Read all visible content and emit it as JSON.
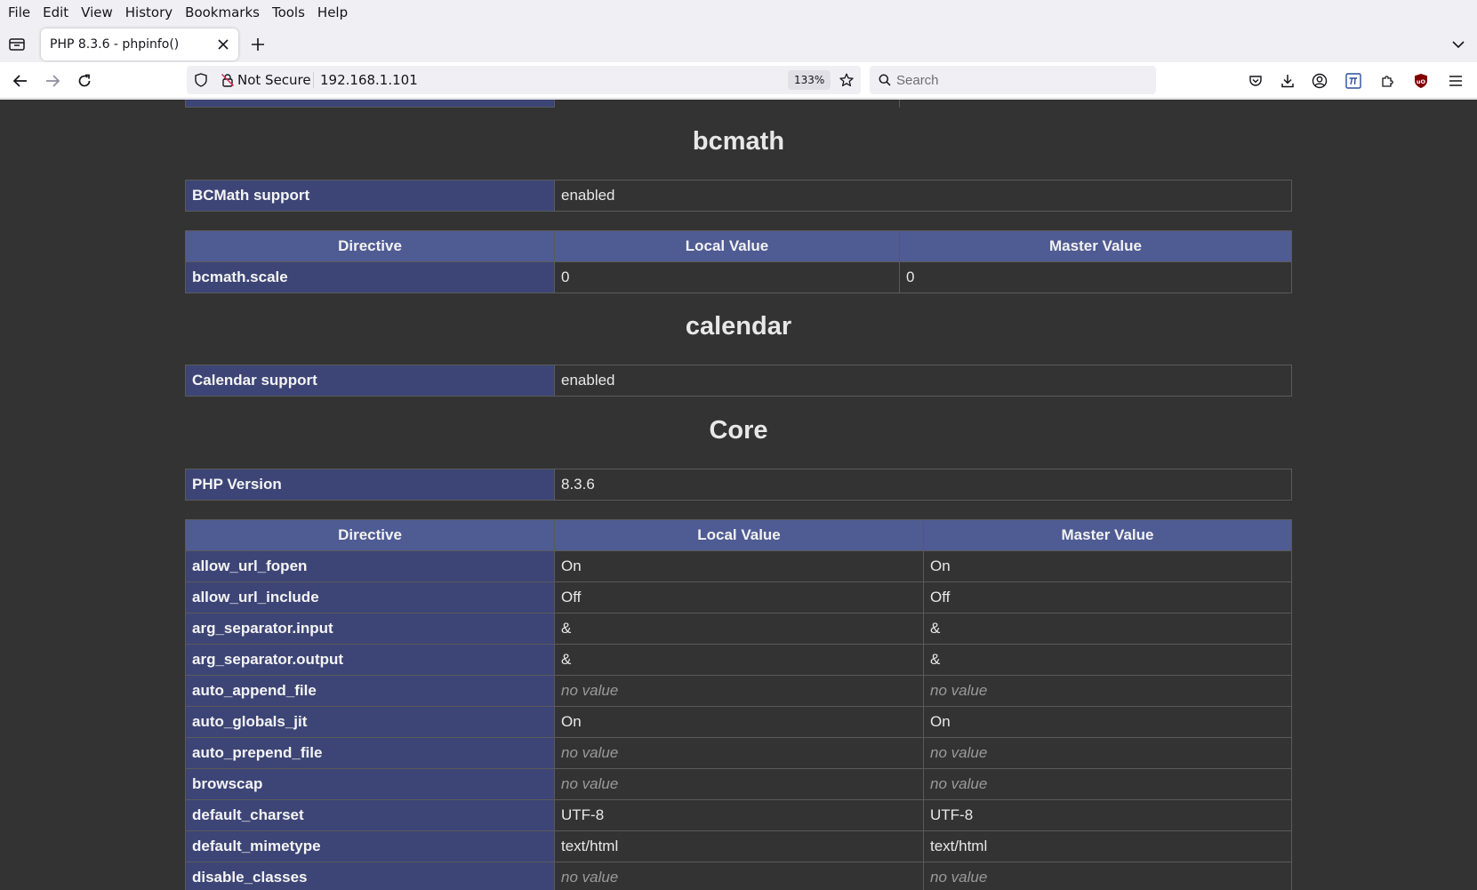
{
  "menu": [
    "File",
    "Edit",
    "View",
    "History",
    "Bookmarks",
    "Tools",
    "Help"
  ],
  "tab": {
    "title": "PHP 8.3.6 - phpinfo()"
  },
  "urlbar": {
    "security_label": "Not Secure",
    "url": "192.168.1.101",
    "zoom": "133%"
  },
  "search": {
    "placeholder": "Search"
  },
  "bcmath": {
    "heading": "bcmath",
    "support": {
      "label": "BCMath support",
      "value": "enabled"
    },
    "headers": [
      "Directive",
      "Local Value",
      "Master Value"
    ],
    "rows": [
      {
        "name": "bcmath.scale",
        "local": "0",
        "master": "0"
      }
    ]
  },
  "calendar": {
    "heading": "calendar",
    "support": {
      "label": "Calendar support",
      "value": "enabled"
    }
  },
  "core": {
    "heading": "Core",
    "version": {
      "label": "PHP Version",
      "value": "8.3.6"
    },
    "headers": [
      "Directive",
      "Local Value",
      "Master Value"
    ],
    "rows": [
      {
        "name": "allow_url_fopen",
        "local": "On",
        "master": "On"
      },
      {
        "name": "allow_url_include",
        "local": "Off",
        "master": "Off"
      },
      {
        "name": "arg_separator.input",
        "local": "&",
        "master": "&"
      },
      {
        "name": "arg_separator.output",
        "local": "&",
        "master": "&"
      },
      {
        "name": "auto_append_file",
        "local": "no value",
        "master": "no value"
      },
      {
        "name": "auto_globals_jit",
        "local": "On",
        "master": "On"
      },
      {
        "name": "auto_prepend_file",
        "local": "no value",
        "master": "no value"
      },
      {
        "name": "browscap",
        "local": "no value",
        "master": "no value"
      },
      {
        "name": "default_charset",
        "local": "UTF-8",
        "master": "UTF-8"
      },
      {
        "name": "default_mimetype",
        "local": "text/html",
        "master": "text/html"
      },
      {
        "name": "disable_classes",
        "local": "no value",
        "master": "no value"
      }
    ]
  },
  "colors": {
    "header_bg": "#4f5b93",
    "key_bg": "#3d4576",
    "page_bg": "#333333"
  }
}
